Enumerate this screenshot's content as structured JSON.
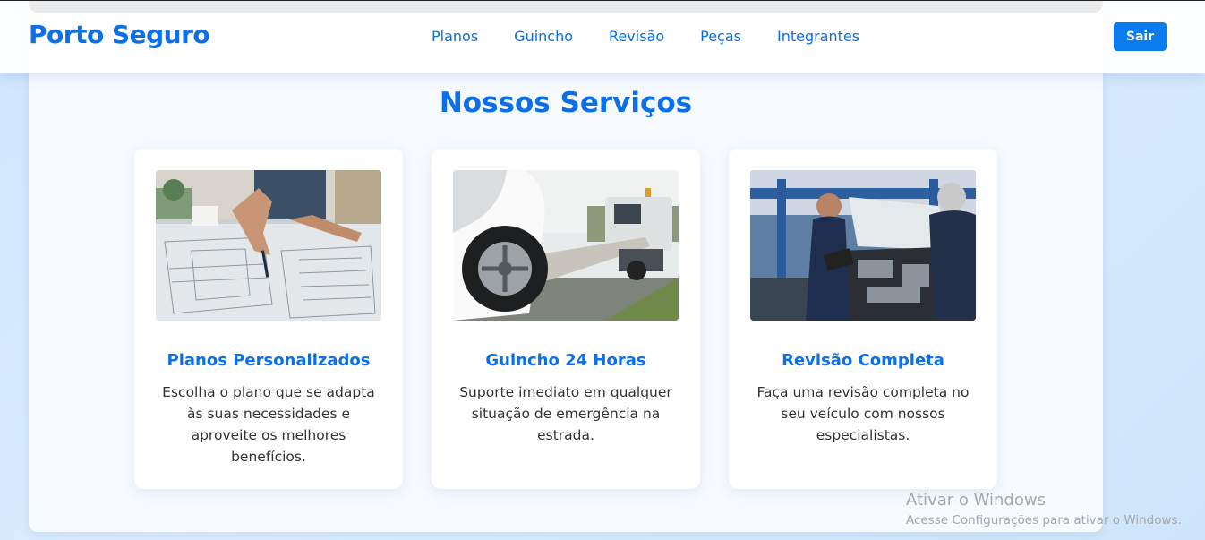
{
  "header": {
    "brand": "Porto Seguro",
    "nav": [
      "Planos",
      "Guincho",
      "Revisão",
      "Peças",
      "Integrantes"
    ],
    "logout_label": "Sair"
  },
  "section": {
    "title": "Nossos Serviços"
  },
  "cards": [
    {
      "image": "blueprint-planning-photo",
      "title": "Planos Personalizados",
      "description": "Escolha o plano que se adapta às suas necessidades e aproveite os melhores benefícios."
    },
    {
      "image": "tow-truck-photo",
      "title": "Guincho 24 Horas",
      "description": "Suporte imediato em qualquer situação de emergência na estrada."
    },
    {
      "image": "mechanics-engine-photo",
      "title": "Revisão Completa",
      "description": "Faça uma revisão completa no seu veículo com nossos especialistas."
    }
  ],
  "watermark": {
    "title": "Ativar o Windows",
    "subtitle": "Acesse Configurações para ativar o Windows."
  },
  "colors": {
    "accent": "#0a6fe8",
    "button": "#0a7cf0",
    "background": "#d4e8fc"
  }
}
